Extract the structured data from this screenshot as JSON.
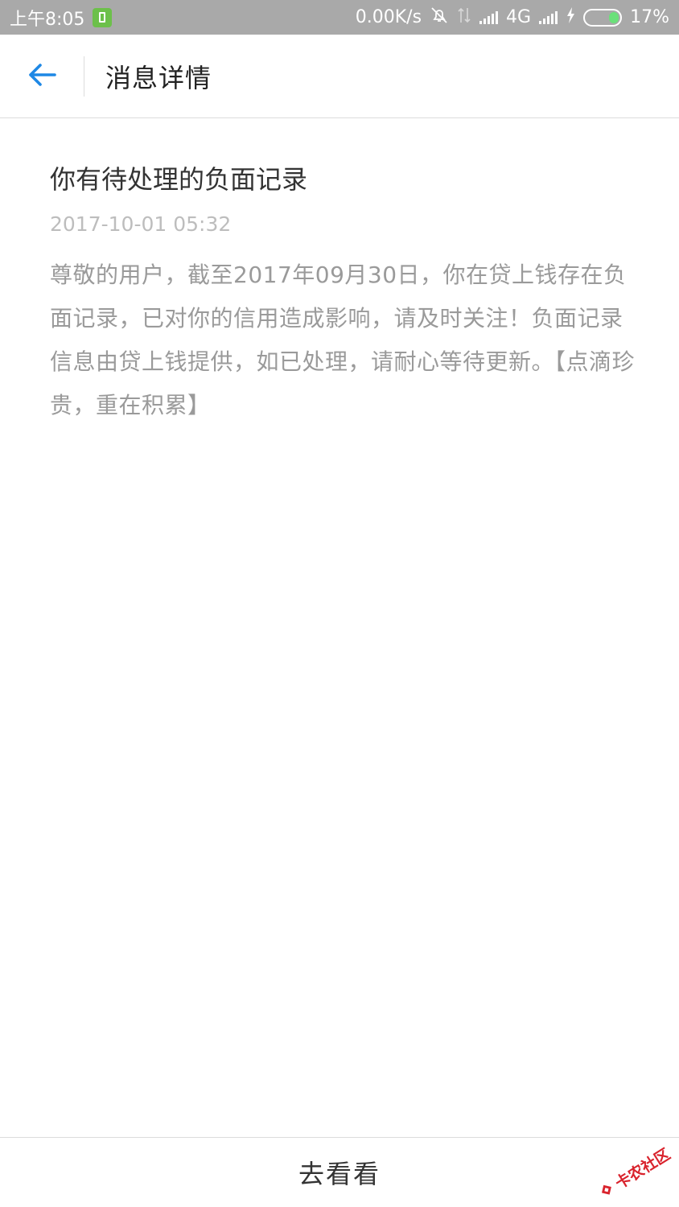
{
  "status_bar": {
    "time": "上午8:05",
    "net_speed": "0.00K/s",
    "network_type": "4G",
    "battery_percent": "17%",
    "battery_level": 0.17,
    "icons": [
      "app-notification-icon",
      "mute-bell-icon",
      "data-arrows-icon",
      "signal-icon",
      "signal-icon",
      "charging-icon",
      "battery-icon"
    ]
  },
  "header": {
    "back_icon": "back-arrow-icon",
    "title": "消息详情"
  },
  "message": {
    "title": "你有待处理的负面记录",
    "time": "2017-10-01 05:32",
    "body": "尊敬的用户，截至2017年09月30日，你在贷上钱存在负面记录，已对你的信用造成影响，请及时关注！负面记录信息由贷上钱提供，如已处理，请耐心等待更新。【点滴珍贵，重在积累】"
  },
  "footer": {
    "action_label": "去看看"
  },
  "watermark": {
    "text": "卡农社区"
  },
  "colors": {
    "accent": "#1e88e5",
    "status_bar_bg": "#a9a9a9",
    "watermark": "#d9232d"
  }
}
